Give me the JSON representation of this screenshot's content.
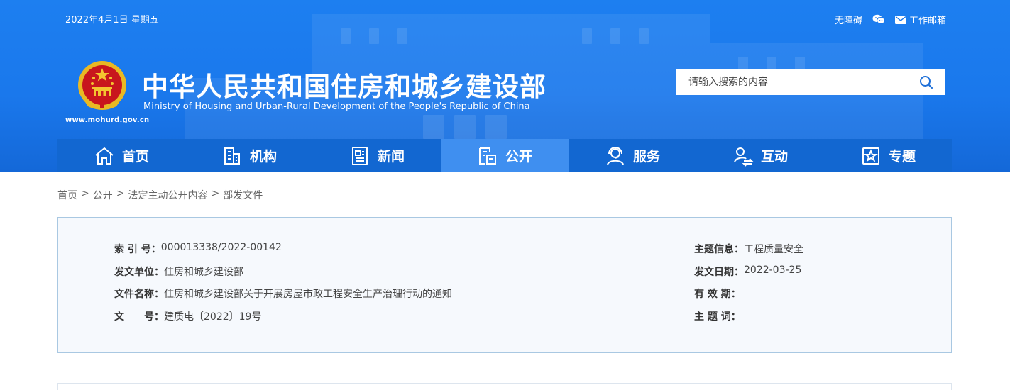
{
  "topbar": {
    "date": "2022年4月1日 星期五",
    "accessibility": "无障碍",
    "mail": "工作邮箱"
  },
  "site": {
    "title_cn": "中华人民共和国住房和城乡建设部",
    "title_en": "Ministry of Housing and Urban-Rural Development of the People's Republic of China",
    "url": "www.mohurd.gov.cn"
  },
  "search": {
    "placeholder": "请输入搜索的内容"
  },
  "nav": {
    "items": [
      {
        "label": "首页",
        "icon": "home-icon"
      },
      {
        "label": "机构",
        "icon": "building-icon"
      },
      {
        "label": "新闻",
        "icon": "news-icon"
      },
      {
        "label": "公开",
        "icon": "disclosure-icon",
        "active": true
      },
      {
        "label": "服务",
        "icon": "service-icon"
      },
      {
        "label": "互动",
        "icon": "interaction-icon"
      },
      {
        "label": "专题",
        "icon": "topic-icon"
      }
    ]
  },
  "breadcrumb": {
    "items": [
      "首页",
      "公开",
      "法定主动公开内容",
      "部发文件"
    ],
    "separator": ">"
  },
  "info": {
    "index_label": "索 引 号：",
    "index_value": "000013338/2022-00142",
    "topic_label": "主题信息：",
    "topic_value": "工程质量安全",
    "issuer_label": "发文单位：",
    "issuer_value": "住房和城乡建设部",
    "date_label": "发文日期：",
    "date_value": "2022-03-25",
    "name_label": "文件名称：",
    "name_value": "住房和城乡建设部关于开展房屋市政工程安全生产治理行动的通知",
    "validity_label": "有 效 期：",
    "validity_value": "",
    "doc_label": "文　　号：",
    "doc_value": "建质电〔2022〕19号",
    "keywords_label": "主 题 词：",
    "keywords_value": ""
  },
  "colors": {
    "header_blue": "#1a78ec",
    "nav_blue": "#1267d1",
    "nav_active": "#3f8ff0",
    "info_bg": "#f6f9fd",
    "info_border": "#a9c8e2"
  }
}
